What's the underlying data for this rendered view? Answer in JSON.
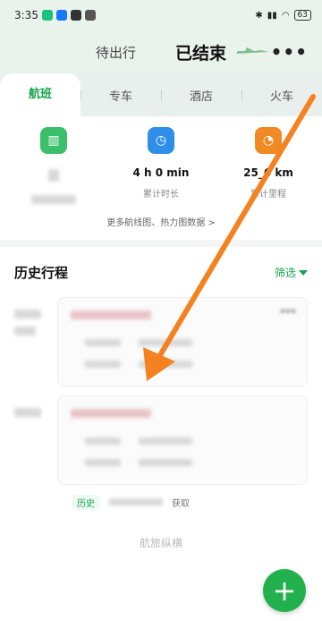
{
  "status": {
    "time": "3:35",
    "battery": "63"
  },
  "top_tabs": [
    {
      "label": "待出行"
    },
    {
      "label": "已结束"
    }
  ],
  "categories": [
    {
      "label": "航班"
    },
    {
      "label": "专车"
    },
    {
      "label": "酒店"
    },
    {
      "label": "火车"
    }
  ],
  "stats": {
    "duration_value": "4 h 0 min",
    "duration_label": "累计时长",
    "distance_value": "25_6 km",
    "distance_label": "累计里程",
    "more_link": "更多航线图、热力图数据 >"
  },
  "history": {
    "title": "历史行程",
    "filter": "筛选"
  },
  "footer": {
    "tag": "历史",
    "text": "获取"
  },
  "brand": "航旅纵横",
  "colors": {
    "accent": "#16a34a",
    "fab": "#22b14c",
    "arrow": "#f58220"
  }
}
